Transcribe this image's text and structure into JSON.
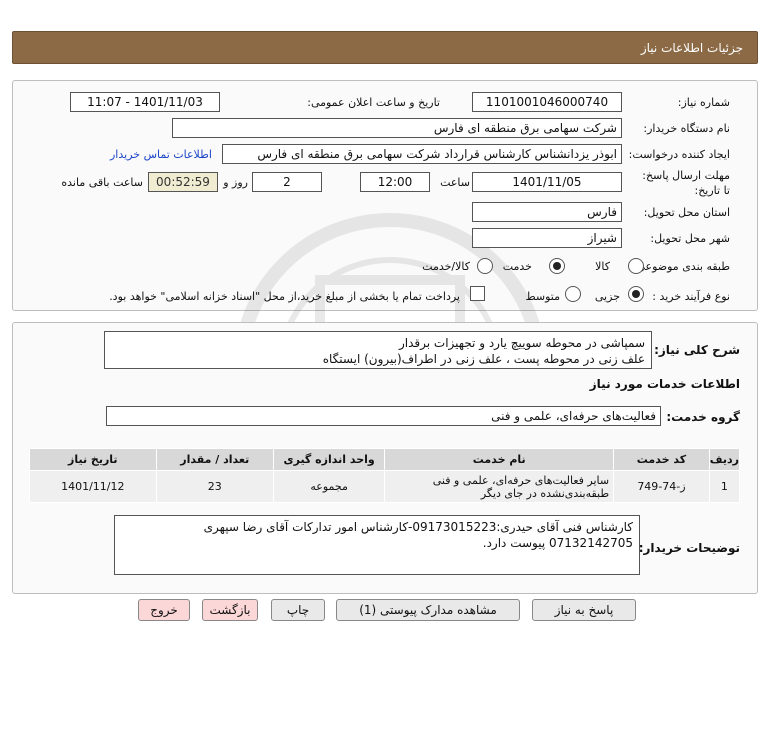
{
  "header": {
    "title": "جزئیات اطلاعات نیاز"
  },
  "info": {
    "need_number_label": "شماره نیاز:",
    "need_number": "1101001046000740",
    "announce_label": "تاریخ و ساعت اعلان عمومی:",
    "announce_value": "1401/11/03 - 11:07",
    "buyer_label": "نام دستگاه خریدار:",
    "buyer_value": "شرکت سهامی برق منطقه ای فارس",
    "creator_label": "ایجاد کننده درخواست:",
    "creator_value": "ابوذر  یزدانشناس کارشناس قرارداد شرکت سهامی برق منطقه ای فارس",
    "contact_link": "اطلاعات تماس خریدار",
    "deadline_label": "مهلت ارسال پاسخ: تا تاریخ:",
    "deadline_date": "1401/11/05",
    "time_label": "ساعت",
    "deadline_time": "12:00",
    "days_value": "2",
    "days_label": "روز و",
    "remaining_time": "00:52:59",
    "remaining_label": "ساعت باقی مانده",
    "province_label": "استان محل تحویل:",
    "province_value": "فارس",
    "city_label": "شهر محل تحویل:",
    "city_value": "شیراز",
    "category_label": "طبقه بندی موضوعی:",
    "category_options": [
      "کالا",
      "خدمت",
      "کالا/خدمت"
    ],
    "category_selected": "خدمت",
    "purchase_label": "نوع فرآیند خرید :",
    "purchase_options": [
      "جزیی",
      "متوسط"
    ],
    "purchase_selected": "جزیی",
    "treasury_note": "پرداخت تمام یا بخشی از مبلغ خرید،از محل \"اسناد خزانه اسلامی\" خواهد بود."
  },
  "summary": {
    "label": "شرح کلی نیاز:",
    "text": "سمپاشی در محوطه سوییچ یارد و تجهیزات برقدار\nعلف زنی در محوطه پست ، علف زنی در اطراف(بیرون) ایستگاه"
  },
  "services": {
    "section_title": "اطلاعات خدمات مورد نیاز",
    "group_label": "گروه خدمت:",
    "group_value": "فعالیت‌های حرفه‌ای، علمی و فنی",
    "columns": [
      "ردیف",
      "کد خدمت",
      "نام خدمت",
      "واحد اندازه گیری",
      "تعداد / مقدار",
      "تاریخ نیاز"
    ],
    "rows": [
      {
        "index": "1",
        "code": "ز-74-749",
        "name": "سایر فعالیت‌های حرفه‌ای، علمی و فنی طبقه‌بندی‌نشده در جای دیگر",
        "unit": "مجموعه",
        "qty": "23",
        "date": "1401/11/12"
      }
    ]
  },
  "buyer_notes": {
    "label": "توضیحات خریدار:",
    "text": "کارشناس فنی آقای حیدری:09173015223-کارشناس امور تدارکات آقای رضا سپهری 07132142705 پیوست دارد."
  },
  "buttons": {
    "reply": "پاسخ به نیاز",
    "attachments": "مشاهده مدارک پیوستی (1)",
    "print": "چاپ",
    "back": "بازگشت",
    "exit": "خروج"
  }
}
